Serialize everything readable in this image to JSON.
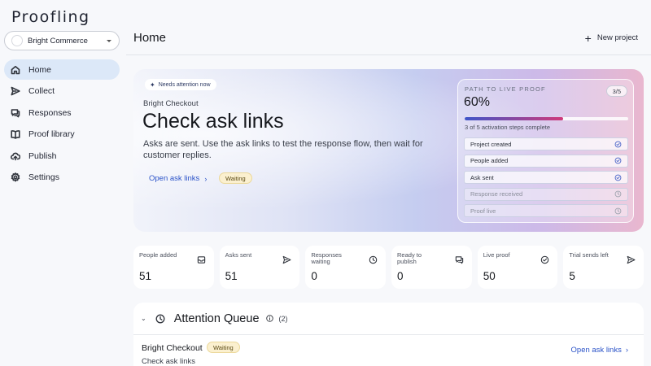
{
  "app": {
    "logo": "Proofling"
  },
  "workspace": {
    "name": "Bright Commerce"
  },
  "sidebar": {
    "items": [
      {
        "label": "Home",
        "icon": "home-icon",
        "active": true
      },
      {
        "label": "Collect",
        "icon": "send-icon",
        "active": false
      },
      {
        "label": "Responses",
        "icon": "chat-icon",
        "active": false
      },
      {
        "label": "Proof library",
        "icon": "book-icon",
        "active": false
      },
      {
        "label": "Publish",
        "icon": "upload-cloud-icon",
        "active": false
      },
      {
        "label": "Settings",
        "icon": "gear-icon",
        "active": false
      }
    ]
  },
  "header": {
    "title": "Home",
    "new_project_label": "New project"
  },
  "hero": {
    "pill": "Needs attention now",
    "subtitle": "Bright Checkout",
    "title": "Check ask links",
    "description": "Asks are sent. Use the ask links to test the response flow, then wait for customer replies.",
    "link_label": "Open ask links",
    "status": "Waiting"
  },
  "path": {
    "label": "PATH TO LIVE PROOF",
    "count": "3/5",
    "percent_label": "60%",
    "progress": 0.6,
    "steps_text": "3 of 5 activation steps complete",
    "steps": [
      {
        "label": "Project created",
        "done": true
      },
      {
        "label": "People added",
        "done": true
      },
      {
        "label": "Ask sent",
        "done": true
      },
      {
        "label": "Response received",
        "done": false
      },
      {
        "label": "Proof live",
        "done": false
      }
    ]
  },
  "stats": [
    {
      "label": "People added",
      "value": "51",
      "icon": "inbox-icon"
    },
    {
      "label": "Asks sent",
      "value": "51",
      "icon": "send-icon"
    },
    {
      "label": "Responses waiting",
      "value": "0",
      "icon": "clock-icon"
    },
    {
      "label": "Ready to publish",
      "value": "0",
      "icon": "chat-icon"
    },
    {
      "label": "Live proof",
      "value": "50",
      "icon": "check-circle-icon"
    },
    {
      "label": "Trial sends left",
      "value": "5",
      "icon": "send-icon"
    }
  ],
  "queue": {
    "title": "Attention Queue",
    "count": "(2)",
    "rows": [
      {
        "title": "Bright Checkout",
        "status": "Waiting",
        "subtitle": "Check ask links",
        "link_label": "Open ask links"
      }
    ]
  }
}
